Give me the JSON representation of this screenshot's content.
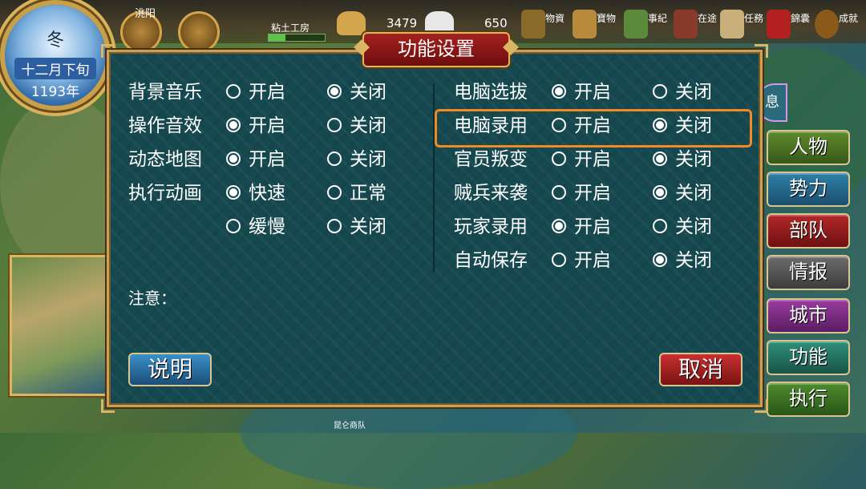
{
  "hud": {
    "season": "冬",
    "date": "十二月下旬",
    "year": "1193年",
    "city": "洮阳",
    "building": "粘土工房",
    "resources": [
      {
        "name": "gold-icon",
        "value": "3479"
      },
      {
        "name": "food-icon",
        "value": "650"
      }
    ],
    "menu": [
      {
        "label": "物資",
        "icon": "goods-icon"
      },
      {
        "label": "寶物",
        "icon": "treasure-icon"
      },
      {
        "label": "事紀",
        "icon": "chronicle-icon"
      },
      {
        "label": "在途",
        "icon": "transit-icon"
      },
      {
        "label": "任務",
        "icon": "task-icon"
      },
      {
        "label": "錦囊",
        "icon": "brocade-bag-icon"
      },
      {
        "label": "成就",
        "icon": "achievement-icon"
      }
    ],
    "info_tab": "息",
    "bottom_label": "昆仑商队"
  },
  "side_menu": [
    {
      "label": "人物",
      "style": "side-g"
    },
    {
      "label": "势力",
      "style": "side-b"
    },
    {
      "label": "部队",
      "style": "side-r"
    },
    {
      "label": "情报",
      "style": "side-gr"
    },
    {
      "label": "城市",
      "style": "side-p"
    },
    {
      "label": "功能",
      "style": "side-t"
    },
    {
      "label": "执行",
      "style": "side-e"
    }
  ],
  "dialog": {
    "title": "功能设置",
    "note": "注意：",
    "help_button": "说明",
    "cancel_button": "取消",
    "left_settings": [
      {
        "label": "背景音乐",
        "options": [
          {
            "text": "开启",
            "selected": false
          },
          {
            "text": "关闭",
            "selected": true
          }
        ]
      },
      {
        "label": "操作音效",
        "options": [
          {
            "text": "开启",
            "selected": true
          },
          {
            "text": "关闭",
            "selected": false
          }
        ]
      },
      {
        "label": "动态地图",
        "options": [
          {
            "text": "开启",
            "selected": true
          },
          {
            "text": "关闭",
            "selected": false
          }
        ]
      },
      {
        "label": "执行动画",
        "options": [
          {
            "text": "快速",
            "selected": true
          },
          {
            "text": "正常",
            "selected": false
          }
        ]
      },
      {
        "label": "",
        "options": [
          {
            "text": "缓慢",
            "selected": false
          },
          {
            "text": "关闭",
            "selected": false
          }
        ]
      }
    ],
    "right_settings": [
      {
        "label": "电脑选拔",
        "options": [
          {
            "text": "开启",
            "selected": true
          },
          {
            "text": "关闭",
            "selected": false
          }
        ]
      },
      {
        "label": "电脑录用",
        "options": [
          {
            "text": "开启",
            "selected": false
          },
          {
            "text": "关闭",
            "selected": true
          }
        ]
      },
      {
        "label": "官员叛变",
        "options": [
          {
            "text": "开启",
            "selected": false
          },
          {
            "text": "关闭",
            "selected": true
          }
        ]
      },
      {
        "label": "贼兵来袭",
        "options": [
          {
            "text": "开启",
            "selected": false
          },
          {
            "text": "关闭",
            "selected": true
          }
        ]
      },
      {
        "label": "玩家录用",
        "options": [
          {
            "text": "开启",
            "selected": true
          },
          {
            "text": "关闭",
            "selected": false
          }
        ]
      },
      {
        "label": "自动保存",
        "options": [
          {
            "text": "开启",
            "selected": false
          },
          {
            "text": "关闭",
            "selected": true
          }
        ]
      }
    ]
  }
}
